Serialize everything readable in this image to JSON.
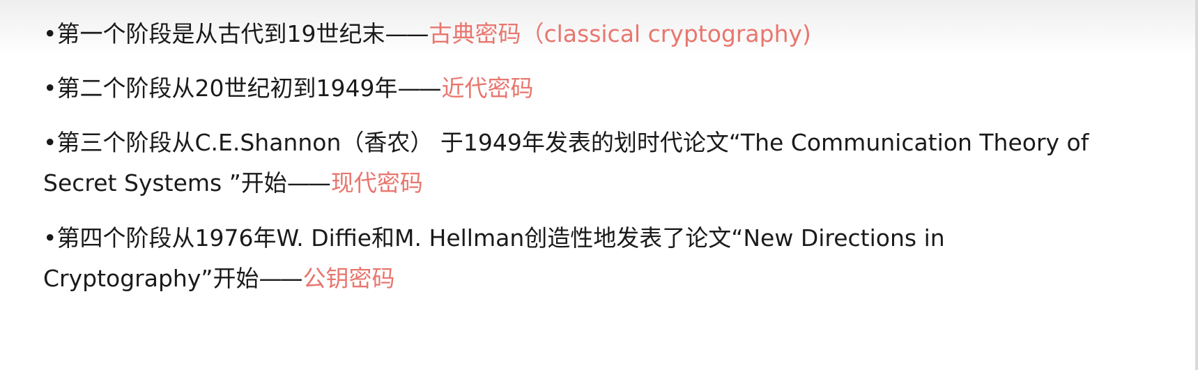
{
  "slide": {
    "bullets": [
      {
        "marker": "•",
        "lines": [
          {
            "text": "第一个阶段是从古代到19世纪末",
            "dash": "——",
            "highlight": "古典密码（classical cryptography)"
          }
        ]
      },
      {
        "marker": "•",
        "lines": [
          {
            "text": "第二个阶段从20世纪初到1949年",
            "dash": "——",
            "highlight": "近代密码"
          }
        ]
      },
      {
        "marker": "•",
        "lines": [
          {
            "text": "第三个阶段从C.E.Shannon（香农） 于1949年发表的划时代论文“The Communication Theory of",
            "dash": "",
            "highlight": ""
          },
          {
            "text": "Secret Systems ”开始",
            "dash": "——",
            "highlight": "现代密码"
          }
        ]
      },
      {
        "marker": "•",
        "lines": [
          {
            "text": "第四个阶段从1976年W. Diffie和M. Hellman创造性地发表了论文“New Directions in",
            "dash": "",
            "highlight": ""
          },
          {
            "text": "Cryptography”开始",
            "dash": "——",
            "highlight": "公钥密码"
          }
        ]
      }
    ],
    "colors": {
      "text": "#1a1a1a",
      "highlight": "#e8766e",
      "background": "#ffffff"
    }
  }
}
